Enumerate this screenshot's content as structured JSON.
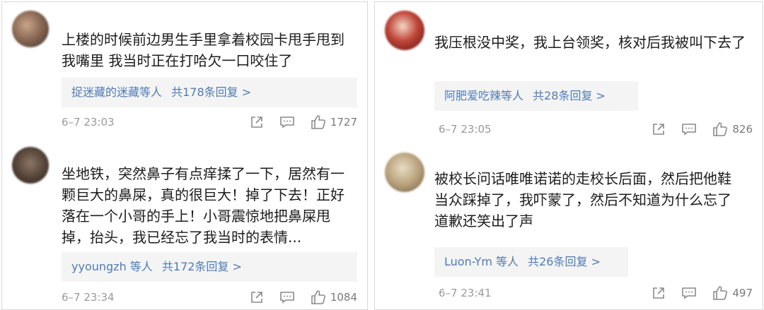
{
  "comments": [
    {
      "panel": "left",
      "username": "",
      "text": "上楼的时候前边男生手里拿着校园卡甩手甩到我嘴里 我当时正在打哈欠一口咬住了",
      "reply_users": "捉迷藏的迷藏等人",
      "reply_count": "共178条回复 >",
      "time": "6–7 23:03",
      "likes": "1727"
    },
    {
      "panel": "left",
      "username": "",
      "text": "坐地铁，突然鼻子有点痒揉了一下，居然有一颗巨大的鼻屎，真的很巨大！掉了下去！正好落在一个小哥的手上！小哥震惊地把鼻屎甩掉，抬头，我已经忘了我当时的表情...",
      "reply_users": "yyoungzh 等人",
      "reply_count": "共172条回复 >",
      "time": "6–7 23:34",
      "likes": "1084"
    },
    {
      "panel": "right",
      "username": "",
      "text": "我压根没中奖，我上台领奖，核对后我被叫下去了",
      "reply_users": "阿肥爱吃辣等人",
      "reply_count": "共28条回复 >",
      "time": "6–7 23:05",
      "likes": "826"
    },
    {
      "panel": "right",
      "username": "",
      "text": "被校长问话唯唯诺诺的走校长后面，然后把他鞋当众踩掉了，我吓蒙了，然后不知道为什么忘了道歉还笑出了声",
      "reply_users": "Luon-Ym 等人",
      "reply_count": "共26条回复 >",
      "time": "6–7 23:41",
      "likes": "497"
    }
  ],
  "icons": {
    "share": "share-icon",
    "comment": "comment-icon",
    "like": "thumbs-up-icon"
  },
  "colors": {
    "link": "#4f7bb6",
    "reply_bg": "#f4f4f4",
    "muted": "#9a9a9a"
  }
}
